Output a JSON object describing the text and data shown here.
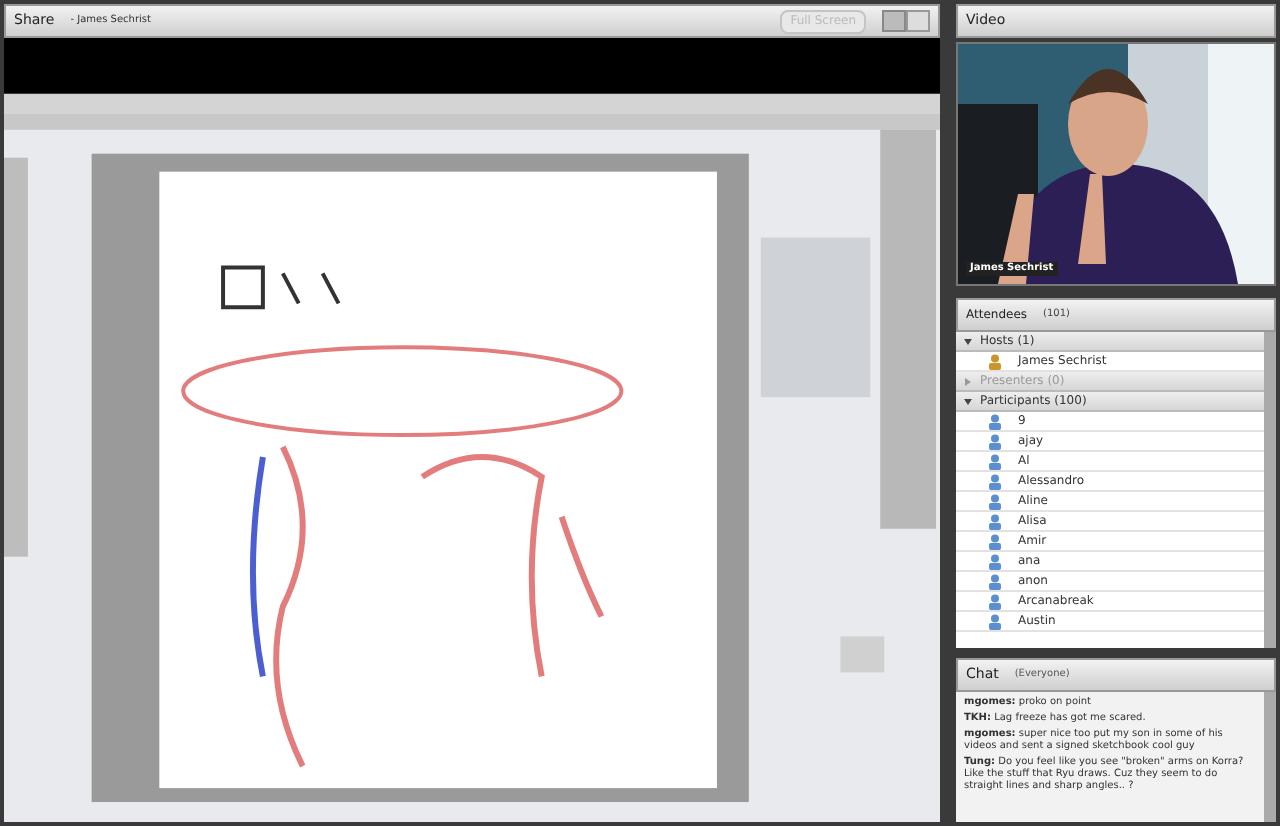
{
  "share": {
    "title": "Share",
    "presenter": "- James Sechrist",
    "full_screen": {
      "label": "Full Screen",
      "disabled": true
    }
  },
  "video": {
    "title": "Video",
    "name": "James Sechrist"
  },
  "attendees": {
    "title": "Attendees",
    "count": "(101)",
    "groups": [
      {
        "label": "Hosts (1)",
        "expanded": true,
        "people": [
          {
            "name": "James Sechrist",
            "kind": "host"
          }
        ]
      },
      {
        "label": "Presenters (0)",
        "expanded": false
      },
      {
        "label": "Participants (100)",
        "expanded": true,
        "people": [
          {
            "name": "9",
            "kind": "participant"
          },
          {
            "name": "ajay",
            "kind": "participant"
          },
          {
            "name": "Al",
            "kind": "participant"
          },
          {
            "name": "Alessandro",
            "kind": "participant"
          },
          {
            "name": "Aline",
            "kind": "participant"
          },
          {
            "name": "Alisa",
            "kind": "participant"
          },
          {
            "name": "Amir",
            "kind": "participant"
          },
          {
            "name": "ana",
            "kind": "participant"
          },
          {
            "name": "anon",
            "kind": "participant"
          },
          {
            "name": "Arcanabreak",
            "kind": "participant"
          },
          {
            "name": "Austin",
            "kind": "participant"
          }
        ]
      }
    ]
  },
  "chat": {
    "title": "Chat",
    "audience": "(Everyone)",
    "messages": [
      {
        "sender": "mgomes:",
        "text": "proko on point"
      },
      {
        "sender": "TKH:",
        "text": "Lag freeze has got me scared."
      },
      {
        "sender": "mgomes:",
        "text": "super nice too put my son in some of his videos and sent a signed sketchbook cool guy"
      },
      {
        "sender": "Tung:",
        "text": "Do you feel like you see \"broken\" arms on Korra? Like the stuff that Ryu draws. Cuz they seem to do straight lines and sharp angles.. ?"
      }
    ]
  }
}
